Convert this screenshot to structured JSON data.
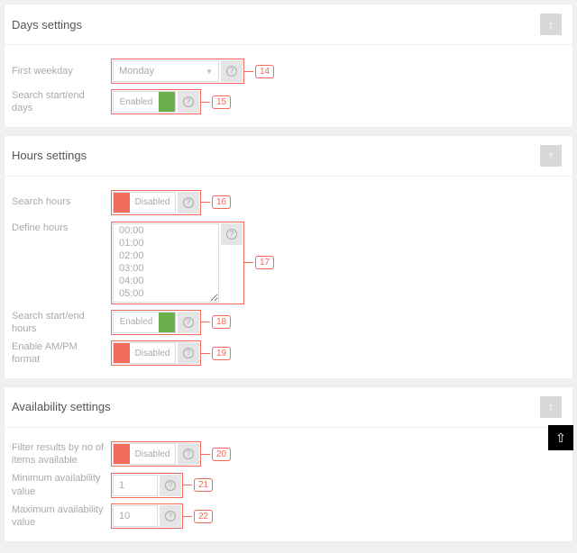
{
  "sections": {
    "days": {
      "title": "Days settings",
      "rows": {
        "first_weekday": {
          "label": "First weekday",
          "value": "Monday",
          "callout": "14"
        },
        "search_days": {
          "label": "Search start/end days",
          "state": "Enabled",
          "callout": "15"
        }
      }
    },
    "hours": {
      "title": "Hours settings",
      "rows": {
        "search_hours": {
          "label": "Search hours",
          "state": "Disabled",
          "callout": "16"
        },
        "define_hours": {
          "label": "Define hours",
          "options": [
            "00:00",
            "01:00",
            "02:00",
            "03:00",
            "04:00",
            "05:00"
          ],
          "callout": "17"
        },
        "search_sehours": {
          "label": "Search start/end hours",
          "state": "Enabled",
          "callout": "18"
        },
        "ampm": {
          "label": "Enable AM/PM format",
          "state": "Disabled",
          "callout": "19"
        }
      }
    },
    "availability": {
      "title": "Availability settings",
      "rows": {
        "filter": {
          "label": "Filter results by no of items available",
          "state": "Disabled",
          "callout": "20"
        },
        "min": {
          "label": "Minimum availability value",
          "value": "1",
          "callout": "21"
        },
        "max": {
          "label": "Maximum availability value",
          "value": "10",
          "callout": "22"
        }
      }
    }
  }
}
